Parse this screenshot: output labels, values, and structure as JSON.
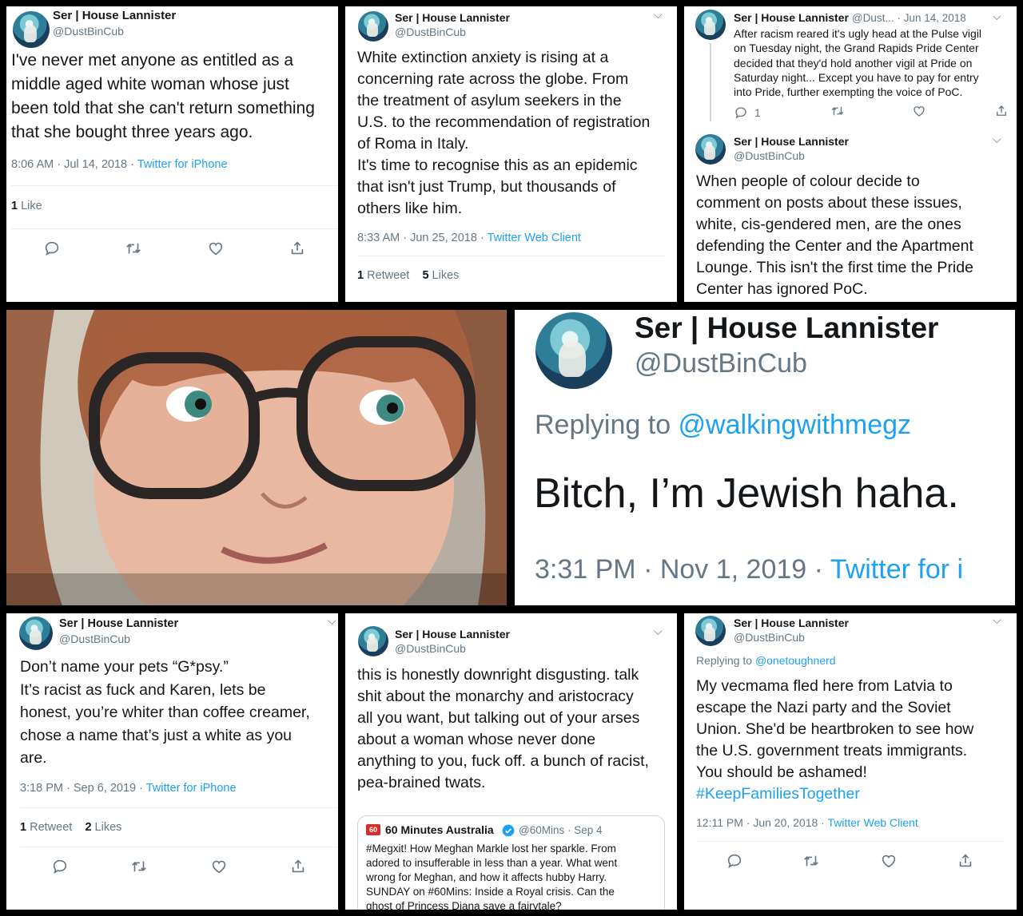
{
  "account": {
    "name": "Ser | House Lannister",
    "handle": "@DustBinCub"
  },
  "tweet1": {
    "text": "I've never met anyone as entitled as a\nmiddle aged white woman whose just\nbeen told that she can't return something\nthat she bought three years ago.",
    "time": "8:06 AM · Jul 14, 2018 · ",
    "client": "Twitter for iPhone",
    "likes_count": "1",
    "likes_label": " Like"
  },
  "tweet2": {
    "text": "White extinction anxiety is rising at a\nconcerning rate across the globe. From\nthe treatment of asylum seekers in the\nU.S. to the recommendation of registration\nof Roma in Italy.\nIt's time to recognise this as an epidemic\nthat isn't just Trump, but thousands of\nothers like him.",
    "time": "8:33 AM · Jun 25, 2018 · ",
    "client": "Twitter Web Client",
    "retweets_count": "1",
    "retweets_label": " Retweet",
    "likes_count": "5",
    "likes_label": " Likes"
  },
  "tweet3": {
    "handle_short": "@Dust...",
    "date": "· Jun 14, 2018",
    "text": "After racism reared it's ugly head at the Pulse vigil\non Tuesday night, the Grand Rapids Pride Center\ndecided that they'd hold another vigil at Pride on\nSaturday night... Except you have to pay for entry\ninto Pride, further exempting the voice of PoC.",
    "reply_count": "1"
  },
  "tweet4": {
    "text": "When people of colour decide to\ncomment on posts about these issues,\nwhite, cis-gendered men, are the ones\ndefending the Center and the Apartment\nLounge. This isn't the first time the Pride\nCenter has ignored PoC."
  },
  "tweet5": {
    "replying_label": "Replying to ",
    "replying_to": "@walkingwithmegz",
    "text": "Bitch, I’m Jewish haha.",
    "time": "3:31 PM · Nov 1, 2019 · ",
    "client": "Twitter for i"
  },
  "tweet6": {
    "text": "Don’t name your pets “G*psy.”\nIt’s racist as fuck and Karen, lets be\nhonest, you’re whiter than coffee creamer,\nchose a name that’s just a white as you\nare.",
    "time": "3:18 PM · Sep 6, 2019 · ",
    "client": "Twitter for iPhone",
    "retweets_count": "1",
    "retweets_label": " Retweet",
    "likes_count": "2",
    "likes_label": " Likes"
  },
  "tweet7": {
    "text": "this is honestly downright disgusting. talk\nshit about the monarchy and aristocracy\nall you want, but talking out of your arses\nabout a woman whose never done\nanything to you, fuck off. a bunch of racist,\npea-brained twats.",
    "quote": {
      "name": "60 Minutes Australia",
      "handle_date": "@60Mins · Sep 4",
      "logo": "60",
      "text": "#Megxit! How Meghan Markle lost her sparkle. From\nadored to insufferable in less than a year. What went\nwrong for Meghan, and how it affects hubby Harry.\nSUNDAY on #60Mins: Inside a Royal crisis. Can the\nghost of Princess Diana save a fairytale?"
    }
  },
  "tweet8": {
    "replying_label": "Replying to ",
    "replying_to": "@onetoughnerd",
    "text": "My vecmama fled here from Latvia to\nescape the Nazi party and the Soviet\nUnion. She'd be heartbroken to see how\nthe U.S. government treats immigrants.\nYou should be ashamed!",
    "hashtag": "#KeepFamiliesTogether",
    "time": "12:11 PM · Jun 20, 2018 · ",
    "client": "Twitter Web Client"
  },
  "icons": [
    "reply-icon",
    "retweet-icon",
    "like-icon",
    "share-icon",
    "chevron-down-icon",
    "verified-badge-icon"
  ],
  "colors": {
    "link": "#1da1f2",
    "muted": "#657786",
    "text": "#14171a",
    "background": "#000000"
  }
}
